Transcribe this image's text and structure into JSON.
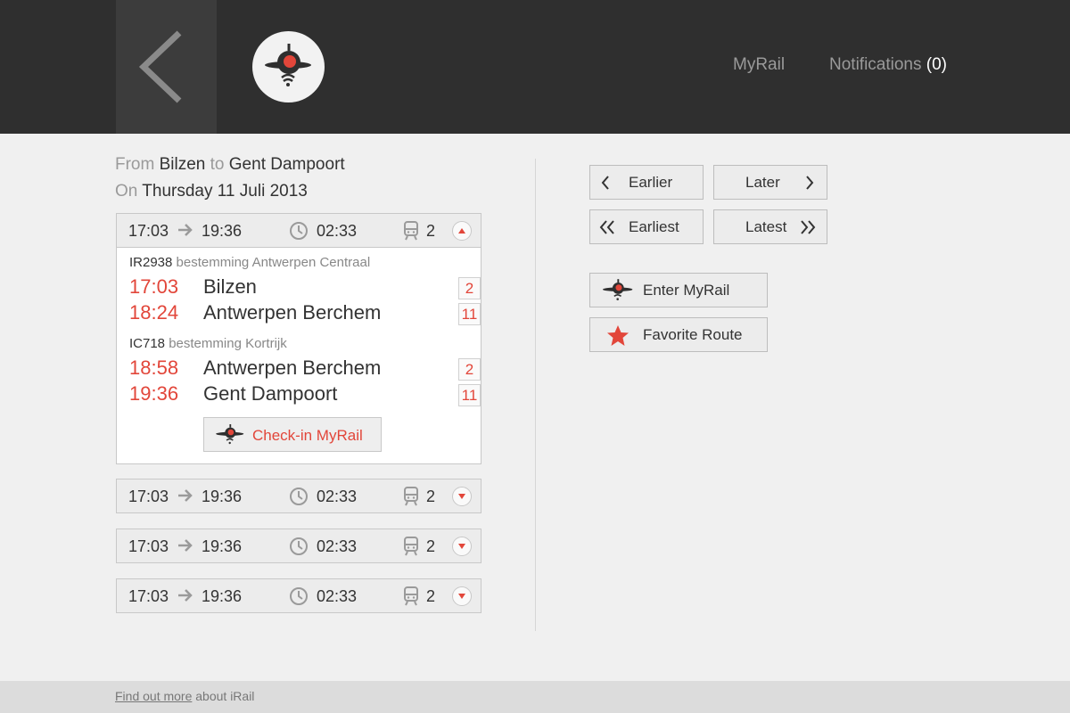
{
  "header": {
    "back_icon": "chevron-left-icon",
    "logo_icon": "irail-logo-icon",
    "nav": {
      "myrail": "MyRail",
      "notifications_label": "Notifications",
      "notifications_count": "(0)"
    }
  },
  "route": {
    "from_label": "From",
    "from": "Bilzen",
    "to_label": "to",
    "to": "Gent Dampoort",
    "on_label": "On",
    "date": "Thursday 11 Juli 2013"
  },
  "trips": [
    {
      "departure": "17:03",
      "arrival": "19:36",
      "duration": "02:33",
      "changes": "2",
      "expanded": true
    },
    {
      "departure": "17:03",
      "arrival": "19:36",
      "duration": "02:33",
      "changes": "2",
      "expanded": false
    },
    {
      "departure": "17:03",
      "arrival": "19:36",
      "duration": "02:33",
      "changes": "2",
      "expanded": false
    },
    {
      "departure": "17:03",
      "arrival": "19:36",
      "duration": "02:33",
      "changes": "2",
      "expanded": false
    }
  ],
  "detail": {
    "legs": [
      {
        "train": "IR2938",
        "destination": "bestemming Antwerpen Centraal",
        "stops": [
          {
            "time": "17:03",
            "station": "Bilzen",
            "platform": "2"
          },
          {
            "time": "18:24",
            "station": "Antwerpen Berchem",
            "platform": "11"
          }
        ]
      },
      {
        "train": "IC718",
        "destination": "bestemming Kortrijk",
        "stops": [
          {
            "time": "18:58",
            "station": "Antwerpen Berchem",
            "platform": "2"
          },
          {
            "time": "19:36",
            "station": "Gent Dampoort",
            "platform": "11"
          }
        ]
      }
    ],
    "checkin_label": "Check-in MyRail"
  },
  "actions": {
    "earlier": "Earlier",
    "later": "Later",
    "earliest": "Earliest",
    "latest": "Latest",
    "enter_myrail": "Enter MyRail",
    "favorite_route": "Favorite Route"
  },
  "footer": {
    "link": "Find out more",
    "text": " about iRail"
  },
  "colors": {
    "accent": "#e2463a",
    "header_bg": "#2f2f2f",
    "page_bg": "#f0f0f0"
  }
}
